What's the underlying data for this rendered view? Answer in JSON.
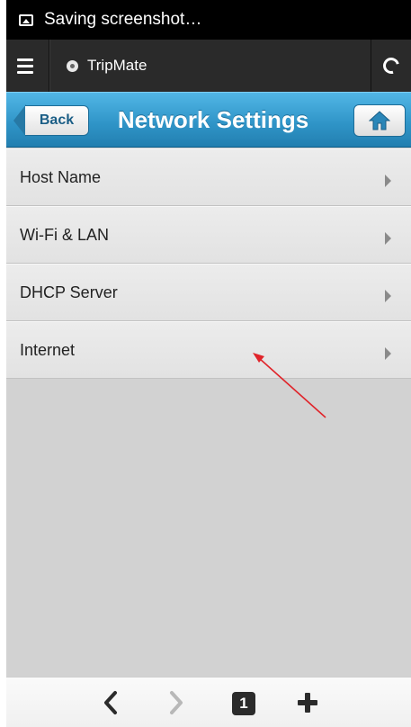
{
  "status_bar": {
    "notification": "Saving screenshot…"
  },
  "browser": {
    "site_title": "TripMate"
  },
  "header": {
    "back_label": "Back",
    "title": "Network Settings"
  },
  "menu": {
    "items": [
      {
        "label": "Host Name"
      },
      {
        "label": "Wi-Fi & LAN"
      },
      {
        "label": "DHCP Server"
      },
      {
        "label": "Internet"
      }
    ]
  },
  "bottom_bar": {
    "tab_count": "1"
  },
  "colors": {
    "header_blue": "#2e93c6",
    "annotation_arrow": "#e0242a"
  },
  "icons": [
    "picture-icon",
    "menu-icon",
    "site-icon",
    "reload-icon",
    "home-icon",
    "chevron-right-icon",
    "back-arrow-icon",
    "forward-arrow-icon",
    "new-tab-icon"
  ]
}
